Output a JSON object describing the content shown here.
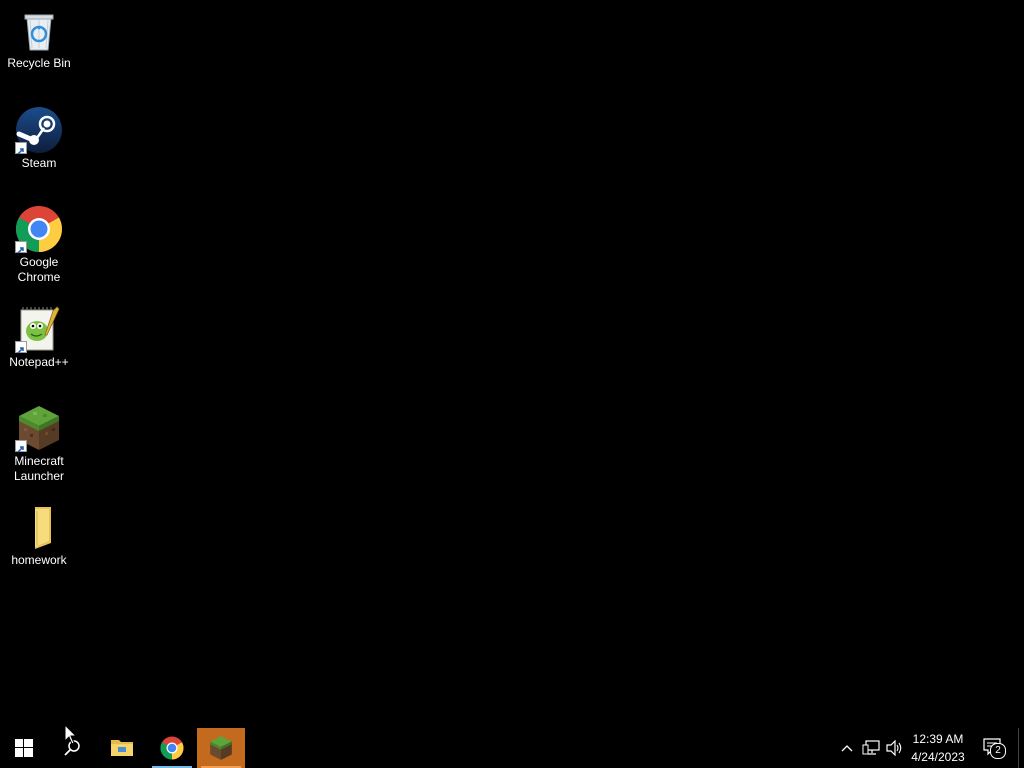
{
  "desktop": {
    "icons": [
      {
        "label": "Recycle Bin",
        "icon": "recycle-bin-icon"
      },
      {
        "label": "Steam",
        "icon": "steam-icon"
      },
      {
        "label": "Google Chrome",
        "icon": "chrome-icon"
      },
      {
        "label": "Notepad++",
        "icon": "notepad-plus-plus-icon"
      },
      {
        "label": "Minecraft Launcher",
        "icon": "minecraft-icon"
      },
      {
        "label": "homework",
        "icon": "folder-icon"
      }
    ]
  },
  "taskbar": {
    "buttons": [
      {
        "icon": "windows-start-icon"
      },
      {
        "icon": "search-icon"
      },
      {
        "icon": "file-explorer-icon"
      },
      {
        "icon": "chrome-icon"
      },
      {
        "icon": "minecraft-icon"
      }
    ],
    "tray": {
      "time": "12:39 AM",
      "date": "4/24/2023",
      "notification_count": "2"
    }
  },
  "colors": {
    "background": "#000000",
    "taskbar": "#000000",
    "active_app": "#c46a1e",
    "running_indicator": "#76b9ed"
  }
}
